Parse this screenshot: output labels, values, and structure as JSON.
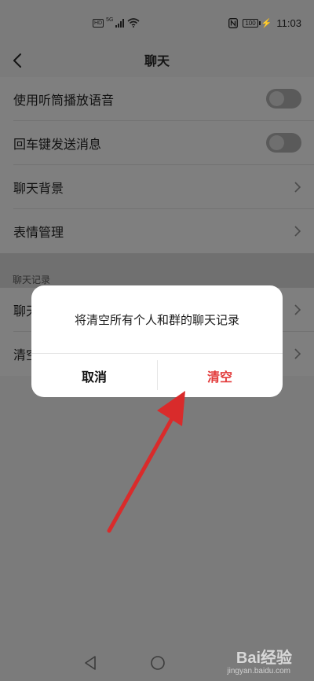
{
  "status_bar": {
    "hd": "HD",
    "network": "5G",
    "battery": "100",
    "time": "11:03",
    "icons": [
      "nfc-icon",
      "signal-icon",
      "wifi-icon",
      "battery-icon"
    ]
  },
  "header": {
    "title": "聊天",
    "back_icon": "chevron-left-icon"
  },
  "settings": {
    "items": [
      {
        "label": "使用听筒播放语音",
        "control": "toggle",
        "on": false
      },
      {
        "label": "回车键发送消息",
        "control": "toggle",
        "on": false
      },
      {
        "label": "聊天背景",
        "control": "chevron"
      },
      {
        "label": "表情管理",
        "control": "chevron"
      }
    ],
    "section_label": "聊天记录",
    "history_items": [
      {
        "label": "聊天记录迁移",
        "control": "chevron"
      },
      {
        "label": "清空聊天记录",
        "control": "chevron"
      }
    ]
  },
  "dialog": {
    "message": "将清空所有个人和群的聊天记录",
    "cancel_label": "取消",
    "confirm_label": "清空",
    "confirm_color": "#e23b3b"
  },
  "annotation": {
    "type": "red-arrow",
    "color": "#d92b2b",
    "points_to": "dialog-confirm-button"
  },
  "watermark": {
    "brand": "Bai经验",
    "url": "jingyan.baidu.com"
  },
  "colors": {
    "dim_background": "#7b7b7b",
    "dialog_background": "#ffffff"
  }
}
